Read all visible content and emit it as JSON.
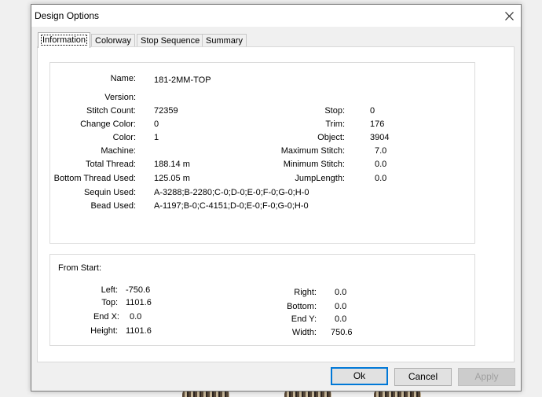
{
  "window": {
    "title": "Design Options"
  },
  "tabs": [
    {
      "label": "Information"
    },
    {
      "label": "Colorway"
    },
    {
      "label": "Stop Sequence"
    },
    {
      "label": "Summary"
    }
  ],
  "info": {
    "name_label": "Name:",
    "name": "181-2MM-TOP",
    "version_label": "Version:",
    "version": "",
    "stitch_count_label": "Stitch Count:",
    "stitch_count": "72359",
    "change_color_label": "Change Color:",
    "change_color": "0",
    "color_label": "Color:",
    "color": "1",
    "machine_label": "Machine:",
    "machine": "",
    "total_thread_label": "Total Thread:",
    "total_thread": "188.14 m",
    "bottom_thread_label": "Bottom Thread Used:",
    "bottom_thread": "125.05 m",
    "sequin_label": "Sequin Used:",
    "sequin": "A-3288;B-2280;C-0;D-0;E-0;F-0;G-0;H-0",
    "bead_label": "Bead Used:",
    "bead": "A-1197;B-0;C-4151;D-0;E-0;F-0;G-0;H-0",
    "stop_label": "Stop:",
    "stop": "0",
    "trim_label": "Trim:",
    "trim": "176",
    "object_label": "Object:",
    "object": "3904",
    "max_stitch_label": "Maximum Stitch:",
    "max_stitch": "7.0",
    "min_stitch_label": "Minimum Stitch:",
    "min_stitch": "0.0",
    "jump_length_label": "JumpLength:",
    "jump_length": "0.0"
  },
  "from_start": {
    "heading": "From Start:",
    "left_label": "Left:",
    "left": "-750.6",
    "top_label": "Top:",
    "top": "1101.6",
    "endx_label": "End X:",
    "endx": "0.0",
    "height_label": "Height:",
    "height": "1101.6",
    "right_label": "Right:",
    "right": "0.0",
    "bottom_label": "Bottom:",
    "bottom": "0.0",
    "endy_label": "End Y:",
    "endy": "0.0",
    "width_label": "Width:",
    "width": "750.6"
  },
  "buttons": {
    "ok": "Ok",
    "cancel": "Cancel",
    "apply": "Apply"
  }
}
